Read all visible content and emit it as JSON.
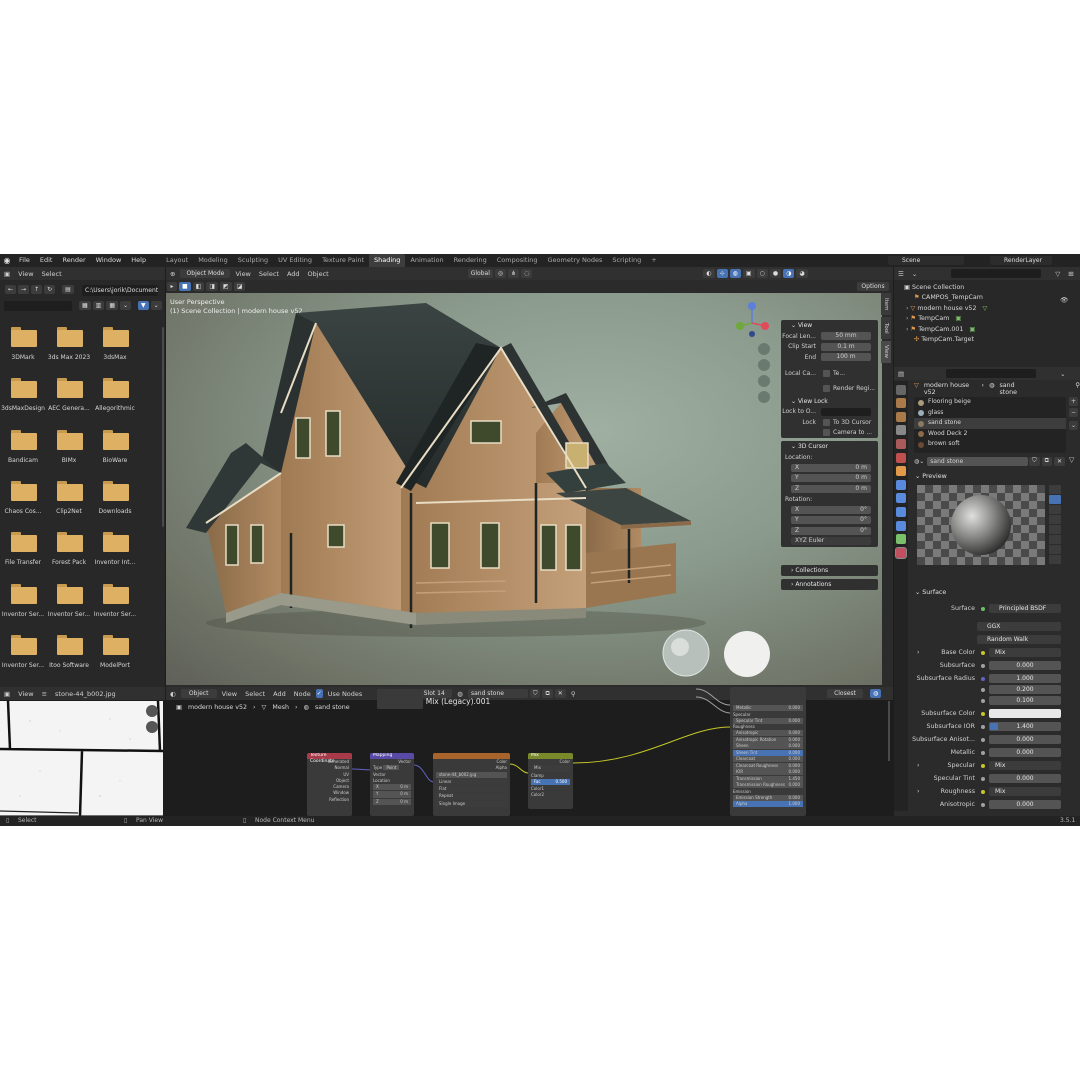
{
  "menu": [
    "File",
    "Edit",
    "Render",
    "Window",
    "Help"
  ],
  "workspaces": [
    "Layout",
    "Modeling",
    "Sculpting",
    "UV Editing",
    "Texture Paint",
    "Shading",
    "Animation",
    "Rendering",
    "Compositing",
    "Geometry Nodes",
    "Scripting"
  ],
  "workspace_add": "+",
  "scene_name": "Scene",
  "view_layer": "RenderLayer",
  "file_browser": {
    "menu": [
      "View",
      "Select"
    ],
    "path": "C:\\Users\\jorik\\Documents\\",
    "folders": [
      "3DMark",
      "3ds Max 2023",
      "3dsMax",
      "3dsMaxDesign",
      "AEC Genera...",
      "Allegorithmic",
      "Bandicam",
      "BIMx",
      "BioWare",
      "Chaos Cos...",
      "Clip2Net",
      "Downloads",
      "File Transfer",
      "Forest Pack",
      "Inventor Int...",
      "Inventor Ser...",
      "Inventor Ser...",
      "Inventor Ser...",
      "Inventor Ser...",
      "Itoo Software",
      "ModelPort"
    ]
  },
  "image_editor": {
    "view_label": "View",
    "image_name": "stone-44_b002.jpg"
  },
  "viewport": {
    "mode": "Object Mode",
    "menu": [
      "View",
      "Select",
      "Add",
      "Object"
    ],
    "orientation": "Global",
    "options": "Options",
    "info_line1": "User Perspective",
    "info_line2": "(1) Scene Collection | modern house v52",
    "side_tabs": [
      "Item",
      "Tool",
      "View"
    ]
  },
  "npanel": {
    "view_header": "View",
    "focal_label": "Focal Len...",
    "focal_value": "50 mm",
    "clip_start_label": "Clip Start",
    "clip_start_value": "0.1 m",
    "clip_end_label": "End",
    "clip_end_value": "100 m",
    "local_camera_label": "Local Ca...",
    "local_camera_value": "Te...",
    "render_region": "Render Regi...",
    "view_lock_header": "View Lock",
    "lock_to_label": "Lock to O...",
    "lock_label": "Lock",
    "to_3d_cursor": "To 3D Cursor",
    "camera_to": "Camera to ...",
    "cursor_header": "3D Cursor",
    "location_label": "Location:",
    "loc_x_label": "X",
    "loc_x": "0 m",
    "loc_y_label": "Y",
    "loc_y": "0 m",
    "loc_z_label": "Z",
    "loc_z": "0 m",
    "rotation_label": "Rotation:",
    "rot_x_label": "X",
    "rot_x": "0°",
    "rot_y_label": "Y",
    "rot_y": "0°",
    "rot_z_label": "Z",
    "rot_z": "0°",
    "rotation_mode": "XYZ Euler",
    "collections": "Collections",
    "annotations": "Annotations"
  },
  "node_editor": {
    "object_label": "Object",
    "menu": [
      "View",
      "Select",
      "Add",
      "Node"
    ],
    "use_nodes": "Use Nodes",
    "slot": "Slot 14",
    "material": "sand stone",
    "breadcrumb_object": "modern house v52",
    "breadcrumb_mesh": "Mesh",
    "breadcrumb_material": "sand stone",
    "frame_title": "Map: Mix (Legacy).001",
    "closest": "Closest",
    "node_texcoord": "Texture Coordinate",
    "texcoord_outputs": [
      "Generated",
      "Normal",
      "UV",
      "Object",
      "Camera",
      "Window",
      "Reflection"
    ],
    "node_mapping": "Mapping",
    "mapping_rows": [
      "Vector",
      "Type",
      "Point",
      "Vector",
      "Location",
      "X",
      "Y",
      "Z"
    ],
    "mapping_values": [
      "0 m",
      "0 m",
      "0 m"
    ],
    "node_image": "stone-44_b002.jpg",
    "image_rows": [
      "Color",
      "Alpha",
      "Linear",
      "Flat",
      "Repeat",
      "Single Image"
    ],
    "node_mix": "Mix",
    "mix_rows": [
      "Color",
      "Mix",
      "Clamp",
      "Fac",
      "Color1",
      "Color2"
    ],
    "mix_fac": "0.500",
    "bsdf_rows": [
      "Metallic",
      "Specular",
      "Specular Tint",
      "Roughness",
      "Anisotropic",
      "Anisotropic Rotation",
      "Sheen",
      "Sheen Tint",
      "Clearcoat",
      "Clearcoat Roughness",
      "IOR",
      "Transmission",
      "Transmission Roughness",
      "Emission",
      "Emission Strength",
      "Alpha"
    ],
    "bsdf_values": [
      "0.000",
      "0.000",
      "0.000",
      "0.000",
      "0.000",
      "0.000",
      "0.000",
      "0.000",
      "0.000",
      "1.450",
      "0.000",
      "0.000",
      "1.000",
      "1.000"
    ]
  },
  "outliner": {
    "root": "Scene Collection",
    "items": [
      "CAMPOS_TempCam",
      "modern house v52",
      "TempCam",
      "TempCam.001",
      "TempCam.Target"
    ]
  },
  "properties": {
    "object_name": "modern house v52",
    "material_name": "sand stone",
    "materials": [
      "Flooring beige",
      "glass",
      "sand stone",
      "Wood Deck 2",
      "brown soft"
    ],
    "material_field": "sand stone",
    "preview_header": "Preview",
    "surface_header": "Surface",
    "surface_label": "Surface",
    "surface_value": "Principled BSDF",
    "distribution": "GGX",
    "subsurface_method": "Random Walk",
    "rows": [
      {
        "label": "Base Color",
        "value": "Mix"
      },
      {
        "label": "Subsurface",
        "value": "0.000"
      },
      {
        "label": "Subsurface Radius",
        "value": "1.000"
      },
      {
        "label": "",
        "value": "0.200"
      },
      {
        "label": "",
        "value": "0.100"
      },
      {
        "label": "Subsurface Color",
        "value": ""
      },
      {
        "label": "Subsurface IOR",
        "value": "1.400"
      },
      {
        "label": "Subsurface Anisot...",
        "value": "0.000"
      },
      {
        "label": "Metallic",
        "value": "0.000"
      },
      {
        "label": "Specular",
        "value": "Mix"
      },
      {
        "label": "Specular Tint",
        "value": "0.000"
      },
      {
        "label": "Roughness",
        "value": "Mix"
      },
      {
        "label": "Anisotropic",
        "value": "0.000"
      }
    ]
  },
  "statusbar": {
    "select": "Select",
    "pan_view": "Pan View",
    "node_context": "Node Context Menu",
    "version": "3.5.1"
  },
  "colors": {
    "accent": "#4772b3",
    "folder": "#deb064",
    "background": "#1d1d1d"
  }
}
